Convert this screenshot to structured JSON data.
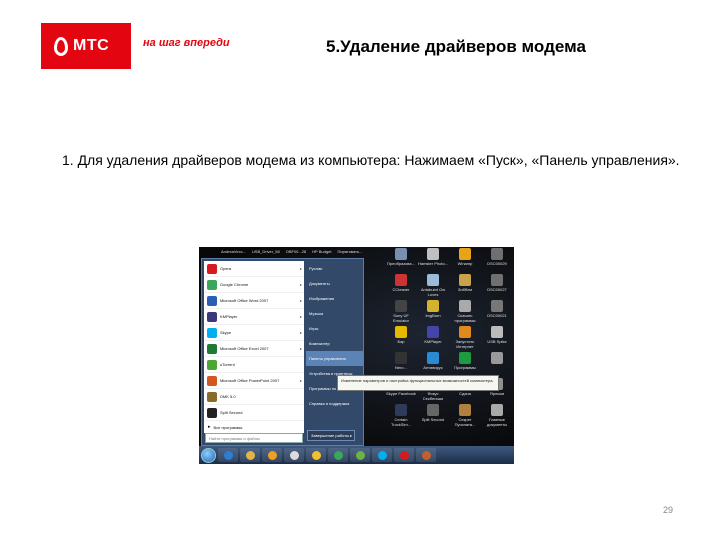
{
  "header": {
    "logo_text": "МТС",
    "slogan": "на шаг впереди",
    "title": "5.Удаление драйверов модема"
  },
  "body": {
    "instruction": "1. Для удаления драйверов модема из компьютера: Нажимаем «Пуск», «Панель управления»."
  },
  "screenshot": {
    "top_strip": [
      "AndreaVecc...",
      "USB_Driver_58",
      "OBF00...28",
      "HP Budget",
      "Пиратовать..."
    ],
    "start_menu": {
      "programs": [
        {
          "label": "Opera",
          "icon": "opera-icon",
          "color": "#d71920",
          "arrow": "▸"
        },
        {
          "label": "Google Chrome",
          "icon": "chrome-icon",
          "color": "#3ba55c",
          "arrow": "▸"
        },
        {
          "label": "Microsoft Office Word 2007",
          "icon": "word-icon",
          "color": "#2b5fb4",
          "arrow": "▸"
        },
        {
          "label": "KMPlayer",
          "icon": "kmplayer-icon",
          "color": "#3a3a7a",
          "arrow": "▸"
        },
        {
          "label": "Skype",
          "icon": "skype-icon",
          "color": "#00aff0",
          "arrow": "▸"
        },
        {
          "label": "Microsoft Office Excel 2007",
          "icon": "excel-icon",
          "color": "#1f7a35",
          "arrow": "▸"
        },
        {
          "label": "uTorrent",
          "icon": "utorrent-icon",
          "color": "#4ca634",
          "arrow": ""
        },
        {
          "label": "Microsoft Office PowerPoint 2007",
          "icon": "powerpoint-icon",
          "color": "#d2581f",
          "arrow": "▸"
        },
        {
          "label": "DMK 5.0",
          "icon": "dmk-icon",
          "color": "#8b6b2a",
          "arrow": ""
        },
        {
          "label": "Split Second",
          "icon": "split-second-icon",
          "color": "#222222",
          "arrow": ""
        }
      ],
      "all_programs": "Все программы",
      "search_placeholder": "Найти программы и файлы",
      "right_items": [
        {
          "label": "Руслан",
          "highlight": false
        },
        {
          "label": "Документы",
          "highlight": false
        },
        {
          "label": "Изображения",
          "highlight": false
        },
        {
          "label": "Музыка",
          "highlight": false
        },
        {
          "label": "Игры",
          "highlight": false
        },
        {
          "label": "Компьютер",
          "highlight": false
        },
        {
          "label": "Панель управления",
          "highlight": true
        },
        {
          "label": "Устройства и принтеры",
          "highlight": false
        },
        {
          "label": "Программы по умолчанию",
          "highlight": false
        },
        {
          "label": "Справка и поддержка",
          "highlight": false
        }
      ],
      "shutdown": "Завершение работы  ▸",
      "tooltip": "Изменение параметров и настройка функциональных возможностей компьютера."
    },
    "desktop_icons": [
      [
        {
          "label": "Преобразова...",
          "color": "#7a8fb0"
        },
        {
          "label": "Hamster Photo...",
          "color": "#c0c0c0"
        },
        {
          "label": "Winamp",
          "color": "#e8a317"
        },
        {
          "label": "DSC00029",
          "color": "#6f6f6f"
        }
      ],
      [
        {
          "label": "CCleaner",
          "color": "#cc3333"
        },
        {
          "label": "Antabutnt Ow Loves",
          "color": "#9bbbd9"
        },
        {
          "label": "Зибблм",
          "color": "#c9a24a"
        },
        {
          "label": "DSC00027",
          "color": "#707070"
        }
      ],
      [
        {
          "label": "Sony UF Emulator",
          "color": "#444444"
        },
        {
          "label": "ImgBurn",
          "color": "#d4b12f"
        },
        {
          "label": "Скачать программы",
          "color": "#aaaaaa"
        },
        {
          "label": "DSC00021",
          "color": "#777777"
        }
      ],
      [
        {
          "label": "Бар",
          "color": "#e6b800"
        },
        {
          "label": "KMPlayer",
          "color": "#4444aa"
        },
        {
          "label": "Запустить Интернет",
          "color": "#e08a1e"
        },
        {
          "label": "USB Spike",
          "color": "#bbbbbb"
        }
      ],
      [
        {
          "label": "Nero...",
          "color": "#333333"
        },
        {
          "label": "Антивирус",
          "color": "#2a8ad4"
        },
        {
          "label": "Программы",
          "color": "#1e9a40"
        },
        {
          "label": "",
          "color": "#999999"
        }
      ],
      [
        {
          "label": "Skype Facebook",
          "color": "#b22"
        },
        {
          "label": "Фокус Секбегаши",
          "color": "#d4a020"
        },
        {
          "label": "Сдача",
          "color": "#3a7cd6"
        },
        {
          "label": "Ярлыки",
          "color": "#8f8f8f"
        }
      ],
      [
        {
          "label": "Certain TruckSim...",
          "color": "#2f3b5a"
        },
        {
          "label": "Split Second",
          "color": "#666666"
        },
        {
          "label": "Секрет Пуосната...",
          "color": "#b08040"
        },
        {
          "label": "Главные документы",
          "color": "#a9a9a9"
        }
      ]
    ],
    "taskbar": [
      {
        "icon": "ie-icon",
        "color": "#2a7fd4"
      },
      {
        "icon": "folder-icon",
        "color": "#e2b34a"
      },
      {
        "icon": "media-player-icon",
        "color": "#f0a020"
      },
      {
        "icon": "cd-icon",
        "color": "#dcdcdc"
      },
      {
        "icon": "winamp-icon",
        "color": "#f0c030"
      },
      {
        "icon": "chrome-icon",
        "color": "#3ba55c"
      },
      {
        "icon": "qip-icon",
        "color": "#6db33f"
      },
      {
        "icon": "skype-icon",
        "color": "#00aff0"
      },
      {
        "icon": "opera-icon",
        "color": "#d71920"
      },
      {
        "icon": "unknown-app-icon",
        "color": "#c06030"
      }
    ]
  },
  "footer": {
    "page_number": "29"
  }
}
